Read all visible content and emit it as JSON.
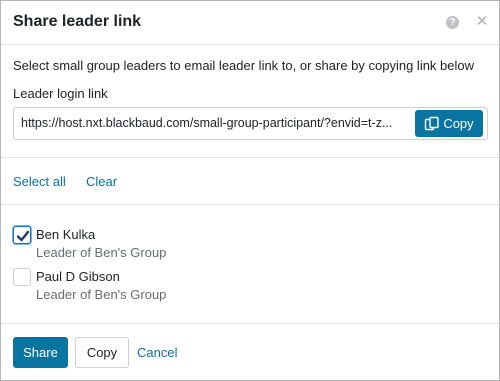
{
  "modal": {
    "title": "Share leader link",
    "help_icon": "?",
    "close_icon": "✕"
  },
  "instructions": "Select small group leaders to email leader link to, or share by copying link below",
  "link": {
    "label": "Leader login link",
    "value": "https://host.nxt.blackbaud.com/small-group-participant/?envid=t-z...",
    "copy_label": "Copy",
    "copy_icon": "copy-icon"
  },
  "selection": {
    "select_all": "Select all",
    "clear": "Clear"
  },
  "leaders": [
    {
      "name": "Ben Kulka",
      "group": "Leader of Ben's Group",
      "checked": true
    },
    {
      "name": "Paul D Gibson",
      "group": "Leader of Ben's Group",
      "checked": false
    }
  ],
  "footer": {
    "share_label": "Share",
    "copy_label": "Copy",
    "cancel_label": "Cancel"
  },
  "colors": {
    "primary": "#0974a1",
    "link": "#0974a1",
    "text": "#212327",
    "muted": "#686c73"
  }
}
